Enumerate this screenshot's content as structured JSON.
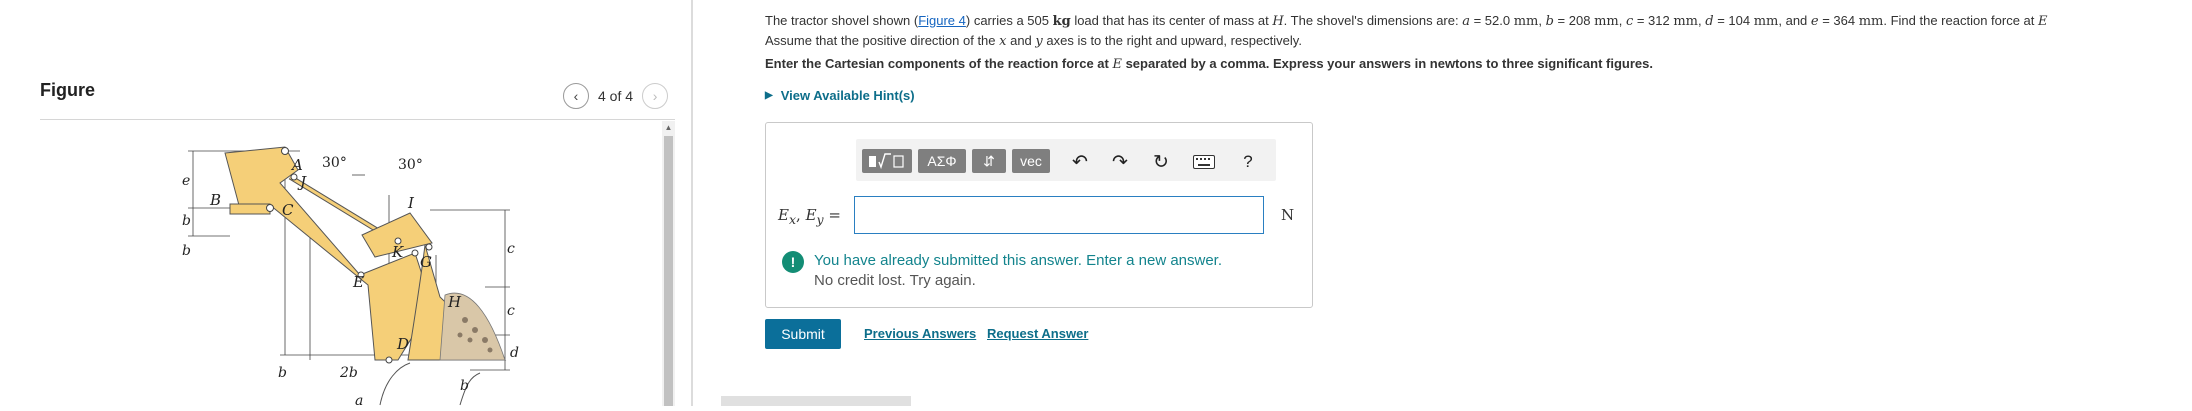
{
  "figure_panel": {
    "title": "Figure",
    "pager": {
      "text": "4 of 4",
      "prev_icon": "chevron-left-icon",
      "next_icon": "chevron-right-icon"
    },
    "diagram": {
      "labels": {
        "A": "A",
        "B": "B",
        "C": "C",
        "J": "J",
        "E": "E",
        "I": "I",
        "K": "K",
        "G": "G",
        "H": "H",
        "D": "D",
        "angle1": "30°",
        "angle2": "30°",
        "dim_e": "e",
        "dim_b1": "b",
        "dim_b2": "b",
        "dim_b3": "b",
        "dim_b4": "b",
        "dim_2b": "2b",
        "dim_c1": "c",
        "dim_c2": "c",
        "dim_d": "d",
        "dim_a": "a"
      }
    }
  },
  "problem": {
    "line1_pre": "The tractor shovel shown (",
    "figure_link": "Figure 4",
    "line1_mid": ") carries a 505 ",
    "mass_unit": "kg",
    "line1_post": " load that has its center of mass at ",
    "point_H": "H",
    "line1_dims": ". The shovel's dimensions are: ",
    "a": "a",
    "a_eq": " = 52.0 ",
    "a_unit": "mm",
    "b": "b",
    "b_eq": " = 208 ",
    "b_unit": "mm",
    "c": "c",
    "c_eq": " = 312 ",
    "c_unit": "mm",
    "d": "d",
    "d_eq": " = 104 ",
    "d_unit": "mm",
    "and": ", and ",
    "e": "e",
    "e_eq": " = 364 ",
    "e_unit": "mm",
    "find": ". Find the reaction force at ",
    "point_E": "E",
    "line2_pre": "Assume that the positive direction of the ",
    "x": "x",
    "line2_and": " and ",
    "y": "y",
    "line2_post": " axes is to the right and upward, respectively.",
    "instruction_pre": "Enter the Cartesian components of the reaction force at ",
    "instruction_E": "E",
    "instruction_post": " separated by a comma. Express your answers  in newtons to three significant figures.",
    "hints": "View Available Hint(s)"
  },
  "answer": {
    "toolbar": {
      "templates_icon": "template-icon",
      "greek": "ΑΣΦ",
      "arrows": "⇵",
      "vec": "vec",
      "undo_icon": "undo-icon",
      "redo_icon": "redo-icon",
      "reset_icon": "reset-icon",
      "keyboard_icon": "keyboard-icon",
      "help": "?"
    },
    "label_Ex": "E",
    "label_x": "x",
    "label_sep": ", ",
    "label_Ey": "E",
    "label_y": "y",
    "label_eq": " =",
    "input_value": "",
    "unit": "N",
    "feedback_title": "You have already submitted this answer. Enter a new answer.",
    "feedback_sub": "No credit lost. Try again."
  },
  "actions": {
    "submit": "Submit",
    "previous_answers": "Previous Answers",
    "request_answer": "Request Answer"
  },
  "colors": {
    "link": "#0d6e8a",
    "submit_bg": "#0b6f9a",
    "feedback": "#13848d",
    "shovel_fill": "#f5cf78"
  }
}
